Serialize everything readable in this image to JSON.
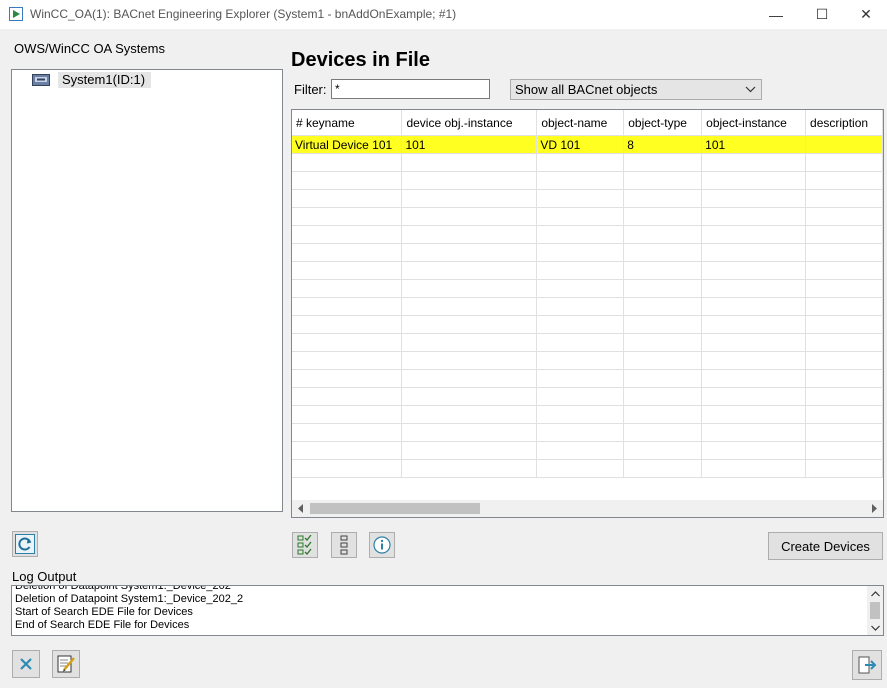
{
  "window": {
    "title": "WinCC_OA(1): BACnet Engineering Explorer (System1 - bnAddOnExample; #1)",
    "minimize_glyph": "—",
    "maximize_glyph": "☐",
    "close_glyph": "✕"
  },
  "systems_panel": {
    "label": "OWS/WinCC OA Systems",
    "tree_items": [
      {
        "label": "System1(ID:1)",
        "icon": "system-icon"
      }
    ]
  },
  "devices_panel": {
    "title": "Devices in File",
    "filter_label": "Filter:",
    "filter_value": "*",
    "object_filter": "Show all BACnet objects",
    "columns": [
      "# keyname",
      "device obj.-instance",
      "object-name",
      "object-type",
      "object-instance",
      "description"
    ],
    "rows": [
      [
        "Virtual Device 101",
        "101",
        "VD 101",
        "8",
        "101",
        ""
      ]
    ],
    "selected_row_color": "#ffff22"
  },
  "toolbar": {
    "refresh_icon": "refresh-icon",
    "select_all_icon": "select-all-checklist-icon",
    "deselect_all_icon": "deselect-all-list-icon",
    "info_icon": "info-icon",
    "create_devices_label": "Create Devices"
  },
  "log": {
    "label": "Log Output",
    "lines": [
      "Deletion of Datapoint System1:_Device_202",
      "Deletion of Datapoint System1:_Device_202_2",
      "Start of Search EDE File for Devices",
      "End of Search EDE File for Devices"
    ]
  },
  "bottom_bar": {
    "clear_icon": "clear-x-icon",
    "edit_icon": "edit-notes-icon",
    "exit_icon": "exit-icon"
  }
}
